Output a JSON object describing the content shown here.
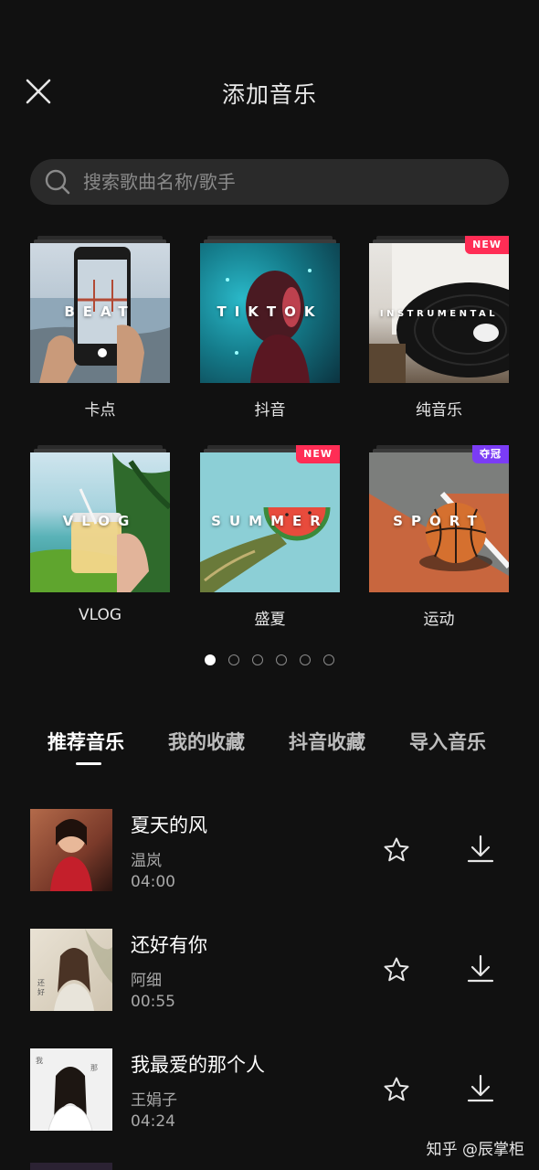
{
  "header": {
    "title": "添加音乐",
    "close_icon": "close-icon"
  },
  "search": {
    "placeholder": "搜索歌曲名称/歌手",
    "icon": "search-icon"
  },
  "categories": [
    {
      "label": "卡点",
      "cover_word": "BEAT",
      "badge": ""
    },
    {
      "label": "抖音",
      "cover_word": "TIKTOK",
      "badge": ""
    },
    {
      "label": "纯音乐",
      "cover_word": "INSTRUMENTAL",
      "badge": "NEW"
    },
    {
      "label": "VLOG",
      "cover_word": "VLOG",
      "badge": ""
    },
    {
      "label": "盛夏",
      "cover_word": "SUMMER",
      "badge": "NEW"
    },
    {
      "label": "运动",
      "cover_word": "SPORT",
      "badge": "夺冠"
    }
  ],
  "pagination": {
    "pages": 6,
    "current": 1
  },
  "tabs": [
    {
      "label": "推荐音乐",
      "active": true
    },
    {
      "label": "我的收藏",
      "active": false
    },
    {
      "label": "抖音收藏",
      "active": false
    },
    {
      "label": "导入音乐",
      "active": false
    }
  ],
  "songs": [
    {
      "title": "夏天的风",
      "artist": "温岚",
      "duration": "04:00"
    },
    {
      "title": "还好有你",
      "artist": "阿细",
      "duration": "00:55"
    },
    {
      "title": "我最爱的那个人",
      "artist": "王娟子",
      "duration": "04:24"
    }
  ],
  "watermark": "知乎 @辰掌柜",
  "colors": {
    "background": "#111111",
    "search_bg": "#2a2a2a",
    "badge_new": "#ff2d55",
    "badge_champion": "#7b3cf5"
  }
}
